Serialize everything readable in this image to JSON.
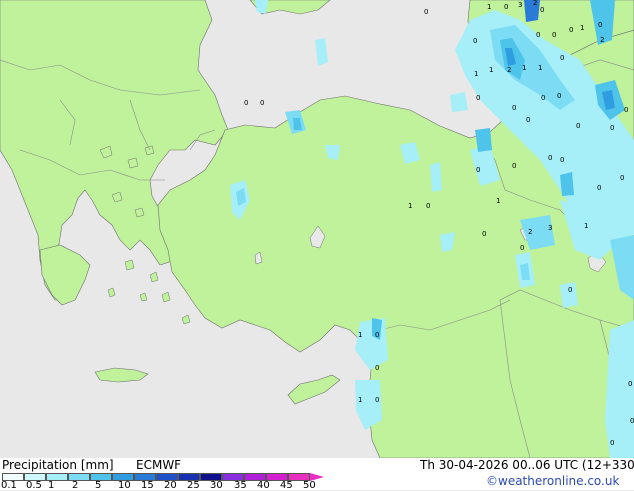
{
  "map": {
    "colors": {
      "sea": "#e8e8e8",
      "land": "#bff29a",
      "border": "#8a8a8a",
      "coast": "#6f6f6f",
      "light_precip": "#a6eef8",
      "mid_precip": "#4fc4ea",
      "heavy_precip": "#3a7fd8"
    },
    "cell_labels": [
      "0",
      "1",
      "0",
      "3",
      "2",
      "0",
      "0",
      "0",
      "0",
      "0",
      "1",
      "1",
      "2",
      "1",
      "1",
      "0",
      "0",
      "0",
      "0",
      "0",
      "0",
      "0",
      "0",
      "0",
      "1",
      "0",
      "0",
      "0",
      "1",
      "0",
      "1",
      "0",
      "0",
      "0",
      "2",
      "3",
      "0",
      "0",
      "0",
      "0",
      "0",
      "1",
      "0",
      "0",
      "1",
      "0",
      "0",
      "1",
      "0",
      "2",
      "0",
      "0"
    ]
  },
  "footer": {
    "left_title": "Precipitation [mm]",
    "model": "ECMWF",
    "datetime": "Th 30-04-2026 00..06 UTC (12+330)",
    "credit": "©weatheronline.co.uk",
    "scale_labels": [
      "0.1",
      "0.5",
      "1",
      "2",
      "5",
      "10",
      "15",
      "20",
      "25",
      "30",
      "35",
      "40",
      "45",
      "50"
    ],
    "scale_colors": [
      "#f2fdff",
      "#cef8fb",
      "#a6eef8",
      "#7cdcf3",
      "#4fc4ea",
      "#2f9ee0",
      "#2a7ad8",
      "#2050c8",
      "#1832b0",
      "#10128c",
      "#8a2fe0",
      "#b020d8",
      "#d420d0",
      "#e830c0"
    ]
  }
}
